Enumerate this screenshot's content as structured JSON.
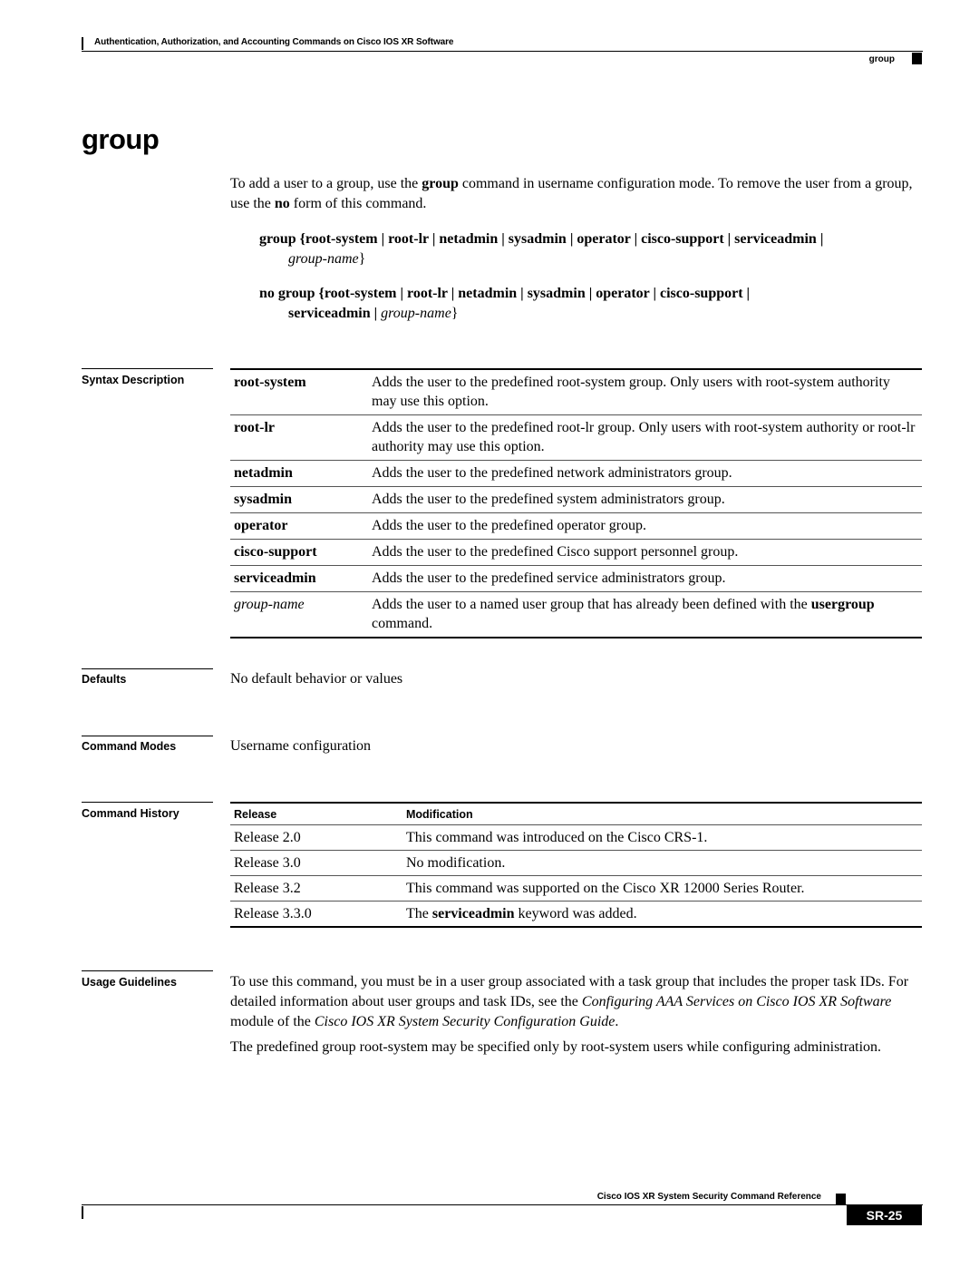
{
  "header": {
    "chapter_title": "Authentication, Authorization, and Accounting Commands on Cisco IOS XR Software",
    "running_head": "group"
  },
  "page_title": "group",
  "intro": {
    "t1": "To add a user to a group, use the ",
    "kw1": "group",
    "t2": " command in username configuration mode. To remove the user from a group, use the ",
    "kw2": "no",
    "t3": " form of this command."
  },
  "syntax": {
    "line1_bold": "group {root-system | root-lr | netadmin | sysadmin | operator | cisco-support | serviceadmin |",
    "line1_cont_italic": "group-name",
    "line1_close": "}",
    "line2_bold": "no group {root-system | root-lr | netadmin | sysadmin | operator | cisco-support |",
    "line2_cont_bold": "serviceadmin |",
    "line2_cont_italic": "group-name",
    "line2_close": "}"
  },
  "sections": {
    "syntax_description": "Syntax Description",
    "defaults": "Defaults",
    "command_modes": "Command Modes",
    "command_history": "Command History",
    "usage_guidelines": "Usage Guidelines"
  },
  "syntax_table": [
    {
      "keyword": "root-system",
      "description": "Adds the user to the predefined root-system group. Only users with root-system authority may use this option."
    },
    {
      "keyword": "root-lr",
      "description": "Adds the user to the predefined root-lr group. Only users with root-system authority or root-lr authority may use this option."
    },
    {
      "keyword": "netadmin",
      "description": "Adds the user to the predefined network administrators group."
    },
    {
      "keyword": "sysadmin",
      "description": "Adds the user to the predefined system administrators group."
    },
    {
      "keyword": "operator",
      "description": "Adds the user to the predefined operator group."
    },
    {
      "keyword": "cisco-support",
      "description": "Adds the user to the predefined Cisco support personnel group."
    },
    {
      "keyword": "serviceadmin",
      "description": "Adds the user to the predefined service administrators group."
    },
    {
      "keyword": "group-name",
      "description_pre": "Adds the user to a named user group that has already been defined with the ",
      "description_bold": "usergroup",
      "description_post": " command."
    }
  ],
  "defaults_text": "No default behavior or values",
  "command_modes_text": "Username configuration",
  "history_table": {
    "headers": [
      "Release",
      "Modification"
    ],
    "rows": [
      {
        "release": "Release 2.0",
        "modification": "This command was introduced on the Cisco CRS-1."
      },
      {
        "release": "Release 3.0",
        "modification": "No modification."
      },
      {
        "release": "Release 3.2",
        "modification": "This command was supported on the Cisco XR 12000 Series Router."
      },
      {
        "release": "Release 3.3.0",
        "mod_pre": "The ",
        "mod_bold": "serviceadmin",
        "mod_post": " keyword was added."
      }
    ]
  },
  "usage": {
    "p1_a": "To use this command, you must be in a user group associated with a task group that includes the proper task IDs. For detailed information about user groups and task IDs, see the ",
    "p1_i1": "Configuring AAA Services on Cisco IOS XR Software",
    "p1_b": " module of the ",
    "p1_i2": "Cisco IOS XR System Security Configuration Guide",
    "p1_c": ".",
    "p2": "The predefined group root-system may be specified only by root-system users while configuring administration."
  },
  "footer": {
    "book_title": "Cisco IOS XR System Security Command Reference",
    "page_number": "SR-25"
  }
}
